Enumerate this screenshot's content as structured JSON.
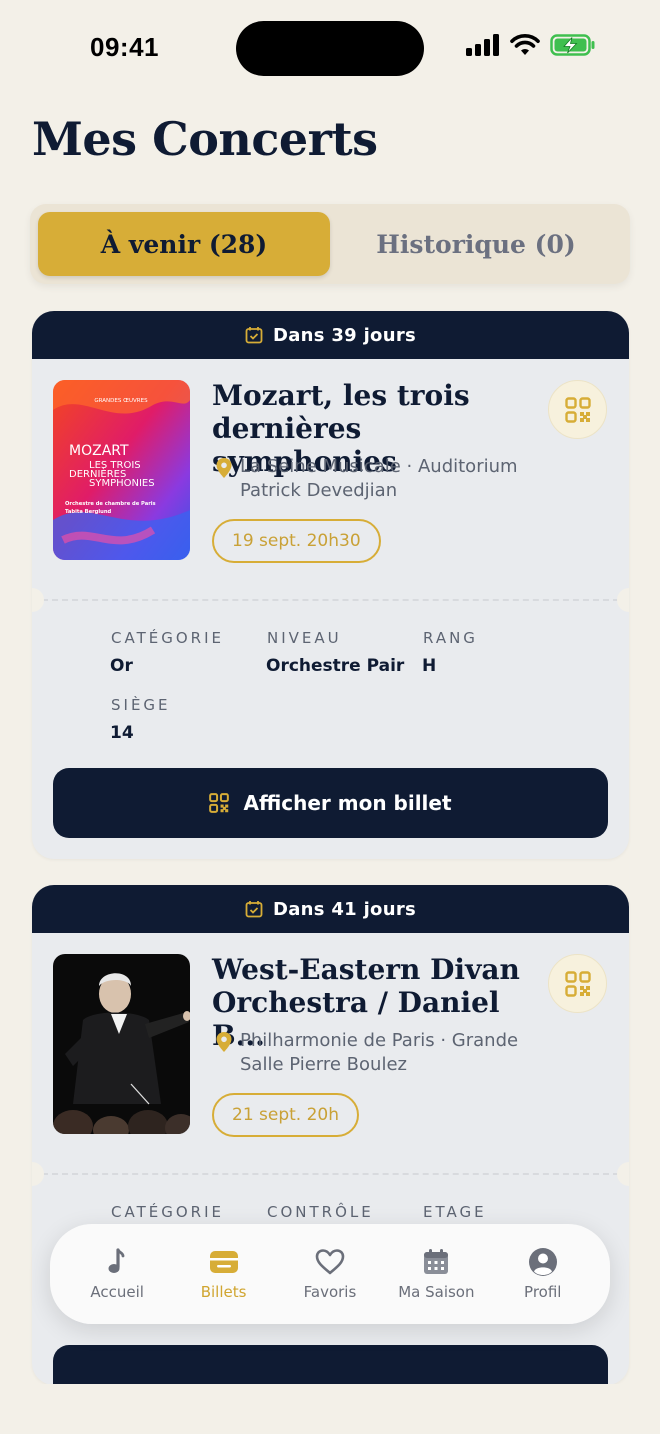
{
  "status_bar": {
    "time": "09:41"
  },
  "page_title": "Mes Concerts",
  "tabs": {
    "upcoming": "À venir (28)",
    "history": "Historique (0)"
  },
  "cards": [
    {
      "countdown": "Dans 39 jours",
      "title": "Mozart, les trois\ndernières symphonies",
      "venue": "La Seine Musicale · Auditorium Patrick Devedjian",
      "date": "19 sept. 20h30",
      "poster": {
        "series": "GRANDES ŒUVRES",
        "line1": "MOZART",
        "line2": "LES TROIS",
        "line3": "DERNIÈRES",
        "line4": "SYMPHONIES",
        "credit1": "Orchestre de chambre de Paris",
        "credit2": "Tabita Berglund"
      },
      "fields": [
        {
          "label": "CATÉGORIE",
          "value": "Or"
        },
        {
          "label": "NIVEAU",
          "value": "Orchestre Pair"
        },
        {
          "label": "RANG",
          "value": "H"
        },
        {
          "label": "SIÈGE",
          "value": "14"
        }
      ],
      "button": "Afficher mon billet"
    },
    {
      "countdown": "Dans 41 jours",
      "title": "West-Eastern Divan\nOrchestra / Daniel B...",
      "venue": "Philharmonie de Paris · Grande Salle Pierre Boulez",
      "date": "21 sept. 20h",
      "fields": [
        {
          "label": "CATÉGORIE",
          "value": ""
        },
        {
          "label": "CONTRÔLE",
          "value": ""
        },
        {
          "label": "ETAGE",
          "value": ""
        }
      ]
    }
  ],
  "nav": [
    {
      "label": "Accueil",
      "icon": "music-note-icon"
    },
    {
      "label": "Billets",
      "icon": "ticket-icon"
    },
    {
      "label": "Favoris",
      "icon": "heart-icon"
    },
    {
      "label": "Ma Saison",
      "icon": "calendar-icon"
    },
    {
      "label": "Profil",
      "icon": "profile-icon"
    }
  ],
  "colors": {
    "navy": "#0f1b33",
    "gold": "#d7ad37",
    "background": "#f3f0e8"
  }
}
